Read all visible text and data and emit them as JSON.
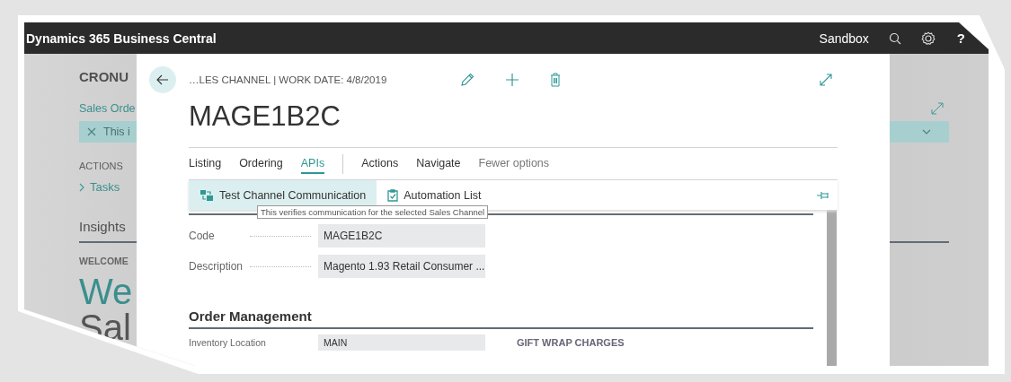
{
  "app_bar": {
    "title": "Dynamics 365 Business Central",
    "environment": "Sandbox",
    "help": "?"
  },
  "background_page": {
    "company": "CRONU",
    "link": "Sales Orde",
    "notification": "This i",
    "actions_heading": "ACTIONS",
    "tasks": "Tasks",
    "insights": "Insights",
    "welcome": "WELCOME",
    "headline_1": "We",
    "headline_2": "Sal"
  },
  "dialog": {
    "breadcrumb": "…LES CHANNEL | WORK DATE: 4/8/2019",
    "title": "MAGE1B2C",
    "tabs": [
      {
        "label": "Listing",
        "selected": false
      },
      {
        "label": "Ordering",
        "selected": false
      },
      {
        "label": "APIs",
        "selected": true
      }
    ],
    "more_tabs": [
      {
        "label": "Actions",
        "selected": false
      },
      {
        "label": "Navigate",
        "selected": false
      }
    ],
    "fewer_options": "Fewer options",
    "actions": [
      {
        "label": "Test Channel Communication",
        "selected": true
      },
      {
        "label": "Automation List",
        "selected": false
      }
    ],
    "tooltip": "This verifies communication for the selected Sales Channel",
    "fields": [
      {
        "label": "Code",
        "value": "MAGE1B2C"
      },
      {
        "label": "Description",
        "value": "Magento 1.93 Retail Consumer ..."
      }
    ],
    "section": "Order Management",
    "bottom_field": {
      "label": "Inventory Location",
      "value": "MAIN"
    },
    "gift_wrap_heading": "GIFT WRAP CHARGES"
  }
}
